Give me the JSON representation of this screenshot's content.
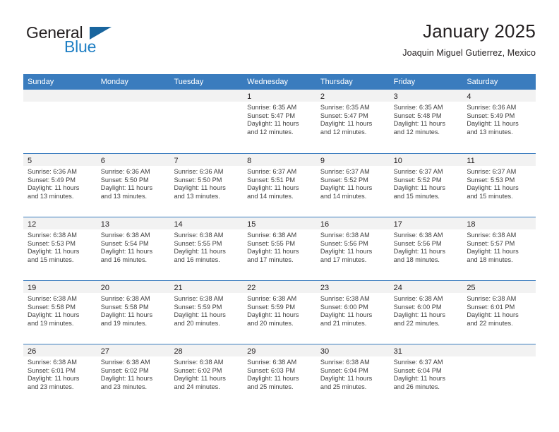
{
  "brand": {
    "name_part1": "General",
    "name_part2": "Blue",
    "accent_color": "#1f7fc4",
    "triangle_color": "#19659e"
  },
  "header": {
    "title": "January 2025",
    "subtitle": "Joaquin Miguel Gutierrez, Mexico"
  },
  "theme": {
    "header_row_bg": "#3a7cbe",
    "day_band_bg": "#f2f2f2",
    "text_color": "#231f20"
  },
  "calendar": {
    "weekdays": [
      "Sunday",
      "Monday",
      "Tuesday",
      "Wednesday",
      "Thursday",
      "Friday",
      "Saturday"
    ],
    "weeks": [
      [
        {
          "day": "",
          "empty": true
        },
        {
          "day": "",
          "empty": true
        },
        {
          "day": "",
          "empty": true
        },
        {
          "day": "1",
          "sunrise": "Sunrise: 6:35 AM",
          "sunset": "Sunset: 5:47 PM",
          "daylight_line1": "Daylight: 11 hours",
          "daylight_line2": "and 12 minutes."
        },
        {
          "day": "2",
          "sunrise": "Sunrise: 6:35 AM",
          "sunset": "Sunset: 5:47 PM",
          "daylight_line1": "Daylight: 11 hours",
          "daylight_line2": "and 12 minutes."
        },
        {
          "day": "3",
          "sunrise": "Sunrise: 6:35 AM",
          "sunset": "Sunset: 5:48 PM",
          "daylight_line1": "Daylight: 11 hours",
          "daylight_line2": "and 12 minutes."
        },
        {
          "day": "4",
          "sunrise": "Sunrise: 6:36 AM",
          "sunset": "Sunset: 5:49 PM",
          "daylight_line1": "Daylight: 11 hours",
          "daylight_line2": "and 13 minutes."
        }
      ],
      [
        {
          "day": "5",
          "sunrise": "Sunrise: 6:36 AM",
          "sunset": "Sunset: 5:49 PM",
          "daylight_line1": "Daylight: 11 hours",
          "daylight_line2": "and 13 minutes."
        },
        {
          "day": "6",
          "sunrise": "Sunrise: 6:36 AM",
          "sunset": "Sunset: 5:50 PM",
          "daylight_line1": "Daylight: 11 hours",
          "daylight_line2": "and 13 minutes."
        },
        {
          "day": "7",
          "sunrise": "Sunrise: 6:36 AM",
          "sunset": "Sunset: 5:50 PM",
          "daylight_line1": "Daylight: 11 hours",
          "daylight_line2": "and 13 minutes."
        },
        {
          "day": "8",
          "sunrise": "Sunrise: 6:37 AM",
          "sunset": "Sunset: 5:51 PM",
          "daylight_line1": "Daylight: 11 hours",
          "daylight_line2": "and 14 minutes."
        },
        {
          "day": "9",
          "sunrise": "Sunrise: 6:37 AM",
          "sunset": "Sunset: 5:52 PM",
          "daylight_line1": "Daylight: 11 hours",
          "daylight_line2": "and 14 minutes."
        },
        {
          "day": "10",
          "sunrise": "Sunrise: 6:37 AM",
          "sunset": "Sunset: 5:52 PM",
          "daylight_line1": "Daylight: 11 hours",
          "daylight_line2": "and 15 minutes."
        },
        {
          "day": "11",
          "sunrise": "Sunrise: 6:37 AM",
          "sunset": "Sunset: 5:53 PM",
          "daylight_line1": "Daylight: 11 hours",
          "daylight_line2": "and 15 minutes."
        }
      ],
      [
        {
          "day": "12",
          "sunrise": "Sunrise: 6:38 AM",
          "sunset": "Sunset: 5:53 PM",
          "daylight_line1": "Daylight: 11 hours",
          "daylight_line2": "and 15 minutes."
        },
        {
          "day": "13",
          "sunrise": "Sunrise: 6:38 AM",
          "sunset": "Sunset: 5:54 PM",
          "daylight_line1": "Daylight: 11 hours",
          "daylight_line2": "and 16 minutes."
        },
        {
          "day": "14",
          "sunrise": "Sunrise: 6:38 AM",
          "sunset": "Sunset: 5:55 PM",
          "daylight_line1": "Daylight: 11 hours",
          "daylight_line2": "and 16 minutes."
        },
        {
          "day": "15",
          "sunrise": "Sunrise: 6:38 AM",
          "sunset": "Sunset: 5:55 PM",
          "daylight_line1": "Daylight: 11 hours",
          "daylight_line2": "and 17 minutes."
        },
        {
          "day": "16",
          "sunrise": "Sunrise: 6:38 AM",
          "sunset": "Sunset: 5:56 PM",
          "daylight_line1": "Daylight: 11 hours",
          "daylight_line2": "and 17 minutes."
        },
        {
          "day": "17",
          "sunrise": "Sunrise: 6:38 AM",
          "sunset": "Sunset: 5:56 PM",
          "daylight_line1": "Daylight: 11 hours",
          "daylight_line2": "and 18 minutes."
        },
        {
          "day": "18",
          "sunrise": "Sunrise: 6:38 AM",
          "sunset": "Sunset: 5:57 PM",
          "daylight_line1": "Daylight: 11 hours",
          "daylight_line2": "and 18 minutes."
        }
      ],
      [
        {
          "day": "19",
          "sunrise": "Sunrise: 6:38 AM",
          "sunset": "Sunset: 5:58 PM",
          "daylight_line1": "Daylight: 11 hours",
          "daylight_line2": "and 19 minutes."
        },
        {
          "day": "20",
          "sunrise": "Sunrise: 6:38 AM",
          "sunset": "Sunset: 5:58 PM",
          "daylight_line1": "Daylight: 11 hours",
          "daylight_line2": "and 19 minutes."
        },
        {
          "day": "21",
          "sunrise": "Sunrise: 6:38 AM",
          "sunset": "Sunset: 5:59 PM",
          "daylight_line1": "Daylight: 11 hours",
          "daylight_line2": "and 20 minutes."
        },
        {
          "day": "22",
          "sunrise": "Sunrise: 6:38 AM",
          "sunset": "Sunset: 5:59 PM",
          "daylight_line1": "Daylight: 11 hours",
          "daylight_line2": "and 20 minutes."
        },
        {
          "day": "23",
          "sunrise": "Sunrise: 6:38 AM",
          "sunset": "Sunset: 6:00 PM",
          "daylight_line1": "Daylight: 11 hours",
          "daylight_line2": "and 21 minutes."
        },
        {
          "day": "24",
          "sunrise": "Sunrise: 6:38 AM",
          "sunset": "Sunset: 6:00 PM",
          "daylight_line1": "Daylight: 11 hours",
          "daylight_line2": "and 22 minutes."
        },
        {
          "day": "25",
          "sunrise": "Sunrise: 6:38 AM",
          "sunset": "Sunset: 6:01 PM",
          "daylight_line1": "Daylight: 11 hours",
          "daylight_line2": "and 22 minutes."
        }
      ],
      [
        {
          "day": "26",
          "sunrise": "Sunrise: 6:38 AM",
          "sunset": "Sunset: 6:01 PM",
          "daylight_line1": "Daylight: 11 hours",
          "daylight_line2": "and 23 minutes."
        },
        {
          "day": "27",
          "sunrise": "Sunrise: 6:38 AM",
          "sunset": "Sunset: 6:02 PM",
          "daylight_line1": "Daylight: 11 hours",
          "daylight_line2": "and 23 minutes."
        },
        {
          "day": "28",
          "sunrise": "Sunrise: 6:38 AM",
          "sunset": "Sunset: 6:02 PM",
          "daylight_line1": "Daylight: 11 hours",
          "daylight_line2": "and 24 minutes."
        },
        {
          "day": "29",
          "sunrise": "Sunrise: 6:38 AM",
          "sunset": "Sunset: 6:03 PM",
          "daylight_line1": "Daylight: 11 hours",
          "daylight_line2": "and 25 minutes."
        },
        {
          "day": "30",
          "sunrise": "Sunrise: 6:38 AM",
          "sunset": "Sunset: 6:04 PM",
          "daylight_line1": "Daylight: 11 hours",
          "daylight_line2": "and 25 minutes."
        },
        {
          "day": "31",
          "sunrise": "Sunrise: 6:37 AM",
          "sunset": "Sunset: 6:04 PM",
          "daylight_line1": "Daylight: 11 hours",
          "daylight_line2": "and 26 minutes."
        },
        {
          "day": "",
          "empty": true
        }
      ]
    ]
  }
}
